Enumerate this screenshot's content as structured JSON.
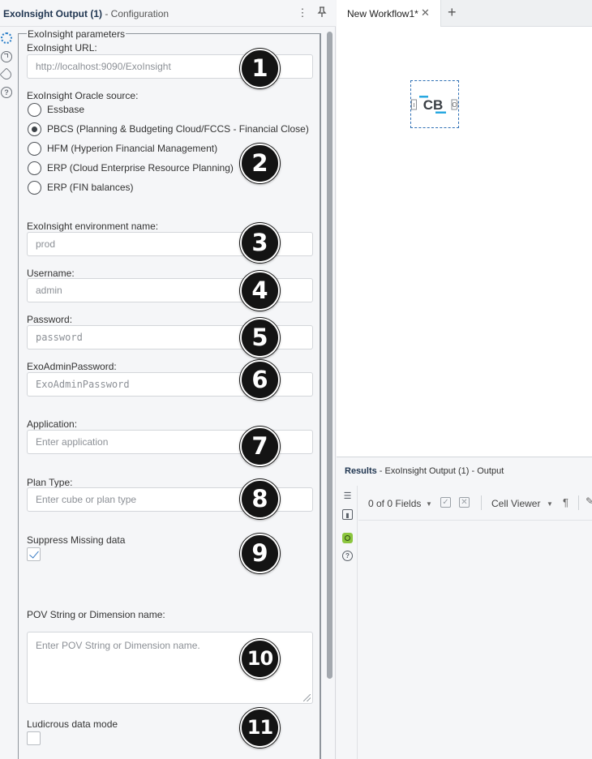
{
  "config_panel": {
    "title_main": "ExoInsight Output (1)",
    "title_sub": " - Configuration",
    "kebab_glyph": "⋮",
    "pin_glyph": "🖈",
    "side_icons": [
      "gear-icon",
      "arrow-circle-icon",
      "tag-icon",
      "help-icon"
    ],
    "help_glyph": "?"
  },
  "form": {
    "legend": "ExoInsight parameters",
    "url_label": "ExoInsight URL:",
    "url_placeholder": "http://localhost:9090/ExoInsight",
    "source_label": "ExoInsight Oracle source:",
    "sources": [
      {
        "label": "Essbase",
        "checked": false
      },
      {
        "label": "PBCS (Planning & Budgeting Cloud/FCCS - Financial Close)",
        "checked": true
      },
      {
        "label": "HFM (Hyperion Financial Management)",
        "checked": false
      },
      {
        "label": "ERP (Cloud Enterprise Resource Planning)",
        "checked": false
      },
      {
        "label": "ERP (FIN balances)",
        "checked": false
      }
    ],
    "env_label": "ExoInsight environment name:",
    "env_placeholder": "prod",
    "username_label": "Username:",
    "username_placeholder": "admin",
    "password_label": "Password:",
    "password_placeholder": "password",
    "admin_password_label": "ExoAdminPassword:",
    "admin_password_placeholder": "ExoAdminPassword",
    "application_label": "Application:",
    "application_placeholder": "Enter application",
    "plan_type_label": "Plan Type:",
    "plan_type_placeholder": "Enter cube or plan type",
    "suppress_label": "Suppress Missing data",
    "suppress_checked": true,
    "pov_label": "POV String or Dimension name:",
    "pov_placeholder": "Enter POV String or Dimension name.",
    "ludicrous_label": "Ludicrous data mode",
    "ludicrous_checked": false
  },
  "badges": [
    "1",
    "2",
    "3",
    "4",
    "5",
    "6",
    "7",
    "8",
    "9",
    "10",
    "11"
  ],
  "canvas": {
    "tab_label": "New Workflow1*",
    "tab_close": "✕",
    "add_tab": "+",
    "tool_text": "CB",
    "tool_in": "I",
    "tool_out": "O"
  },
  "results": {
    "title_main": "Results",
    "title_sub": " - ExoInsight Output (1) - Output",
    "fields_label": "0 of 0 Fields",
    "cell_viewer_label": "Cell Viewer",
    "caret": "▼",
    "check_glyph": "✓",
    "clear_glyph": "✕",
    "pilcrow": "¶",
    "pencil": "✎",
    "list_glyph": "☰",
    "columns_glyph": "▮",
    "help_glyph": "?"
  },
  "colors": {
    "accent": "#2e6fb5",
    "tool_blue": "#29a8e0",
    "badge": "#141414",
    "active_green": "#8cc63f"
  }
}
